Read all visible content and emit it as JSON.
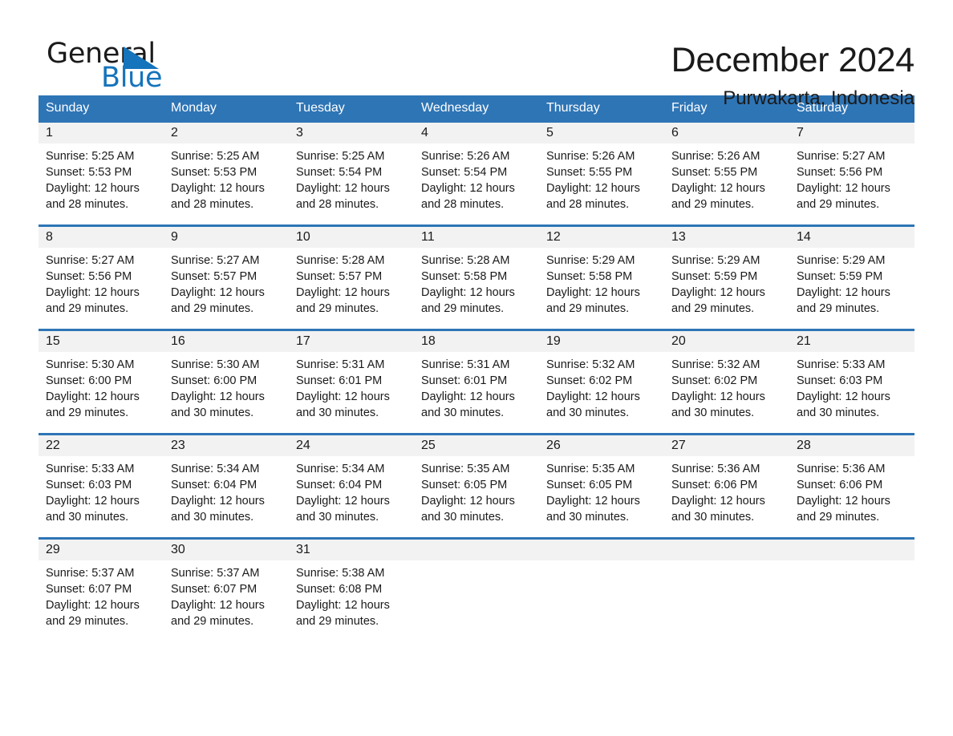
{
  "brand": {
    "name_top": "General",
    "name_bottom": "Blue",
    "triangle_color": "#1574bb"
  },
  "header": {
    "title": "December 2024",
    "subtitle": "Purwakarta, Indonesia"
  },
  "theme": {
    "accent": "#2e75b6",
    "daynum_background": "#f2f2f2",
    "text": "#1a1a1a",
    "header_text": "#ffffff"
  },
  "calendar": {
    "weekdays": [
      "Sunday",
      "Monday",
      "Tuesday",
      "Wednesday",
      "Thursday",
      "Friday",
      "Saturday"
    ],
    "weeks": [
      [
        {
          "day": "1",
          "sunrise": "Sunrise: 5:25 AM",
          "sunset": "Sunset: 5:53 PM",
          "daylight_line1": "Daylight: 12 hours",
          "daylight_line2": "and 28 minutes."
        },
        {
          "day": "2",
          "sunrise": "Sunrise: 5:25 AM",
          "sunset": "Sunset: 5:53 PM",
          "daylight_line1": "Daylight: 12 hours",
          "daylight_line2": "and 28 minutes."
        },
        {
          "day": "3",
          "sunrise": "Sunrise: 5:25 AM",
          "sunset": "Sunset: 5:54 PM",
          "daylight_line1": "Daylight: 12 hours",
          "daylight_line2": "and 28 minutes."
        },
        {
          "day": "4",
          "sunrise": "Sunrise: 5:26 AM",
          "sunset": "Sunset: 5:54 PM",
          "daylight_line1": "Daylight: 12 hours",
          "daylight_line2": "and 28 minutes."
        },
        {
          "day": "5",
          "sunrise": "Sunrise: 5:26 AM",
          "sunset": "Sunset: 5:55 PM",
          "daylight_line1": "Daylight: 12 hours",
          "daylight_line2": "and 28 minutes."
        },
        {
          "day": "6",
          "sunrise": "Sunrise: 5:26 AM",
          "sunset": "Sunset: 5:55 PM",
          "daylight_line1": "Daylight: 12 hours",
          "daylight_line2": "and 29 minutes."
        },
        {
          "day": "7",
          "sunrise": "Sunrise: 5:27 AM",
          "sunset": "Sunset: 5:56 PM",
          "daylight_line1": "Daylight: 12 hours",
          "daylight_line2": "and 29 minutes."
        }
      ],
      [
        {
          "day": "8",
          "sunrise": "Sunrise: 5:27 AM",
          "sunset": "Sunset: 5:56 PM",
          "daylight_line1": "Daylight: 12 hours",
          "daylight_line2": "and 29 minutes."
        },
        {
          "day": "9",
          "sunrise": "Sunrise: 5:27 AM",
          "sunset": "Sunset: 5:57 PM",
          "daylight_line1": "Daylight: 12 hours",
          "daylight_line2": "and 29 minutes."
        },
        {
          "day": "10",
          "sunrise": "Sunrise: 5:28 AM",
          "sunset": "Sunset: 5:57 PM",
          "daylight_line1": "Daylight: 12 hours",
          "daylight_line2": "and 29 minutes."
        },
        {
          "day": "11",
          "sunrise": "Sunrise: 5:28 AM",
          "sunset": "Sunset: 5:58 PM",
          "daylight_line1": "Daylight: 12 hours",
          "daylight_line2": "and 29 minutes."
        },
        {
          "day": "12",
          "sunrise": "Sunrise: 5:29 AM",
          "sunset": "Sunset: 5:58 PM",
          "daylight_line1": "Daylight: 12 hours",
          "daylight_line2": "and 29 minutes."
        },
        {
          "day": "13",
          "sunrise": "Sunrise: 5:29 AM",
          "sunset": "Sunset: 5:59 PM",
          "daylight_line1": "Daylight: 12 hours",
          "daylight_line2": "and 29 minutes."
        },
        {
          "day": "14",
          "sunrise": "Sunrise: 5:29 AM",
          "sunset": "Sunset: 5:59 PM",
          "daylight_line1": "Daylight: 12 hours",
          "daylight_line2": "and 29 minutes."
        }
      ],
      [
        {
          "day": "15",
          "sunrise": "Sunrise: 5:30 AM",
          "sunset": "Sunset: 6:00 PM",
          "daylight_line1": "Daylight: 12 hours",
          "daylight_line2": "and 29 minutes."
        },
        {
          "day": "16",
          "sunrise": "Sunrise: 5:30 AM",
          "sunset": "Sunset: 6:00 PM",
          "daylight_line1": "Daylight: 12 hours",
          "daylight_line2": "and 30 minutes."
        },
        {
          "day": "17",
          "sunrise": "Sunrise: 5:31 AM",
          "sunset": "Sunset: 6:01 PM",
          "daylight_line1": "Daylight: 12 hours",
          "daylight_line2": "and 30 minutes."
        },
        {
          "day": "18",
          "sunrise": "Sunrise: 5:31 AM",
          "sunset": "Sunset: 6:01 PM",
          "daylight_line1": "Daylight: 12 hours",
          "daylight_line2": "and 30 minutes."
        },
        {
          "day": "19",
          "sunrise": "Sunrise: 5:32 AM",
          "sunset": "Sunset: 6:02 PM",
          "daylight_line1": "Daylight: 12 hours",
          "daylight_line2": "and 30 minutes."
        },
        {
          "day": "20",
          "sunrise": "Sunrise: 5:32 AM",
          "sunset": "Sunset: 6:02 PM",
          "daylight_line1": "Daylight: 12 hours",
          "daylight_line2": "and 30 minutes."
        },
        {
          "day": "21",
          "sunrise": "Sunrise: 5:33 AM",
          "sunset": "Sunset: 6:03 PM",
          "daylight_line1": "Daylight: 12 hours",
          "daylight_line2": "and 30 minutes."
        }
      ],
      [
        {
          "day": "22",
          "sunrise": "Sunrise: 5:33 AM",
          "sunset": "Sunset: 6:03 PM",
          "daylight_line1": "Daylight: 12 hours",
          "daylight_line2": "and 30 minutes."
        },
        {
          "day": "23",
          "sunrise": "Sunrise: 5:34 AM",
          "sunset": "Sunset: 6:04 PM",
          "daylight_line1": "Daylight: 12 hours",
          "daylight_line2": "and 30 minutes."
        },
        {
          "day": "24",
          "sunrise": "Sunrise: 5:34 AM",
          "sunset": "Sunset: 6:04 PM",
          "daylight_line1": "Daylight: 12 hours",
          "daylight_line2": "and 30 minutes."
        },
        {
          "day": "25",
          "sunrise": "Sunrise: 5:35 AM",
          "sunset": "Sunset: 6:05 PM",
          "daylight_line1": "Daylight: 12 hours",
          "daylight_line2": "and 30 minutes."
        },
        {
          "day": "26",
          "sunrise": "Sunrise: 5:35 AM",
          "sunset": "Sunset: 6:05 PM",
          "daylight_line1": "Daylight: 12 hours",
          "daylight_line2": "and 30 minutes."
        },
        {
          "day": "27",
          "sunrise": "Sunrise: 5:36 AM",
          "sunset": "Sunset: 6:06 PM",
          "daylight_line1": "Daylight: 12 hours",
          "daylight_line2": "and 30 minutes."
        },
        {
          "day": "28",
          "sunrise": "Sunrise: 5:36 AM",
          "sunset": "Sunset: 6:06 PM",
          "daylight_line1": "Daylight: 12 hours",
          "daylight_line2": "and 29 minutes."
        }
      ],
      [
        {
          "day": "29",
          "sunrise": "Sunrise: 5:37 AM",
          "sunset": "Sunset: 6:07 PM",
          "daylight_line1": "Daylight: 12 hours",
          "daylight_line2": "and 29 minutes."
        },
        {
          "day": "30",
          "sunrise": "Sunrise: 5:37 AM",
          "sunset": "Sunset: 6:07 PM",
          "daylight_line1": "Daylight: 12 hours",
          "daylight_line2": "and 29 minutes."
        },
        {
          "day": "31",
          "sunrise": "Sunrise: 5:38 AM",
          "sunset": "Sunset: 6:08 PM",
          "daylight_line1": "Daylight: 12 hours",
          "daylight_line2": "and 29 minutes."
        },
        {
          "day": "",
          "sunrise": "",
          "sunset": "",
          "daylight_line1": "",
          "daylight_line2": ""
        },
        {
          "day": "",
          "sunrise": "",
          "sunset": "",
          "daylight_line1": "",
          "daylight_line2": ""
        },
        {
          "day": "",
          "sunrise": "",
          "sunset": "",
          "daylight_line1": "",
          "daylight_line2": ""
        },
        {
          "day": "",
          "sunrise": "",
          "sunset": "",
          "daylight_line1": "",
          "daylight_line2": ""
        }
      ]
    ]
  }
}
